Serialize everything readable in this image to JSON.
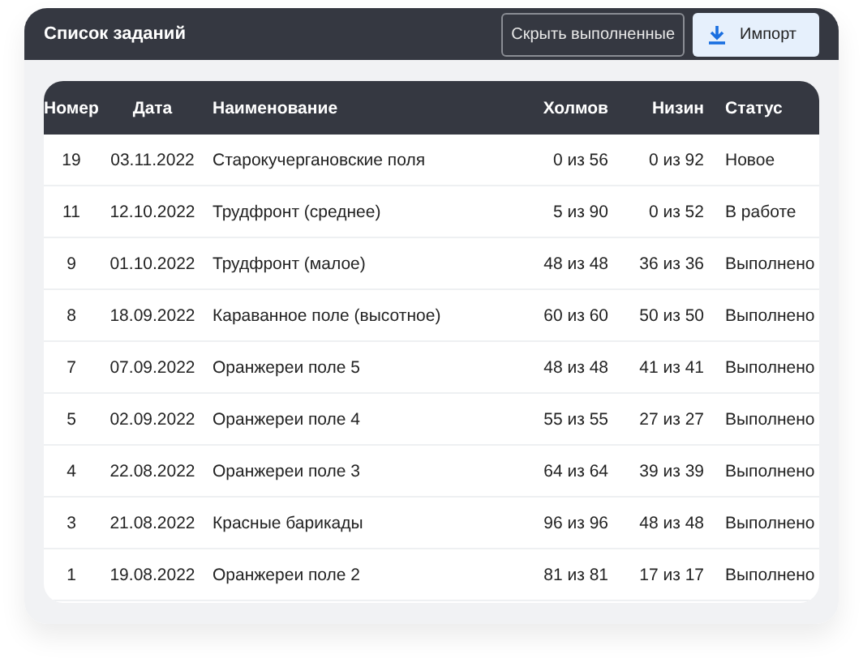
{
  "header": {
    "title": "Список заданий",
    "buttons": [
      {
        "label": "Скрыть выполненные",
        "kind": "outline"
      },
      {
        "label": "Импорт",
        "kind": "import"
      }
    ]
  },
  "table": {
    "columns": [
      "Номер",
      "Дата",
      "Наименование",
      "Холмов",
      "Низин",
      "Статус"
    ],
    "rows": [
      {
        "number": "19",
        "date": "03.11.2022",
        "name": "Старокучергановские поля",
        "hills": "0 из 56",
        "lowlands": "0 из 92",
        "status": "Новое"
      },
      {
        "number": "11",
        "date": "12.10.2022",
        "name": "Трудфронт (среднее)",
        "hills": "5 из 90",
        "lowlands": "0 из 52",
        "status": "В работе"
      },
      {
        "number": "9",
        "date": "01.10.2022",
        "name": "Трудфронт (малое)",
        "hills": "48 из 48",
        "lowlands": "36 из 36",
        "status": "Выполнено"
      },
      {
        "number": "8",
        "date": "18.09.2022",
        "name": "Караванное поле (высотное)",
        "hills": "60 из 60",
        "lowlands": "50 из 50",
        "status": "Выполнено"
      },
      {
        "number": "7",
        "date": "07.09.2022",
        "name": "Оранжереи поле 5",
        "hills": "48 из 48",
        "lowlands": "41 из 41",
        "status": "Выполнено"
      },
      {
        "number": "5",
        "date": "02.09.2022",
        "name": "Оранжереи поле 4",
        "hills": "55 из 55",
        "lowlands": "27 из 27",
        "status": "Выполнено"
      },
      {
        "number": "4",
        "date": "22.08.2022",
        "name": "Оранжереи поле 3",
        "hills": "64 из 64",
        "lowlands": "39 из 39",
        "status": "Выполнено"
      },
      {
        "number": "3",
        "date": "21.08.2022",
        "name": "Красные барикады",
        "hills": "96 из 96",
        "lowlands": "48 из 48",
        "status": "Выполнено"
      },
      {
        "number": "1",
        "date": "19.08.2022",
        "name": "Оранжереи поле 2",
        "hills": "81 из 81",
        "lowlands": "17 из 17",
        "status": "Выполнено"
      }
    ]
  }
}
